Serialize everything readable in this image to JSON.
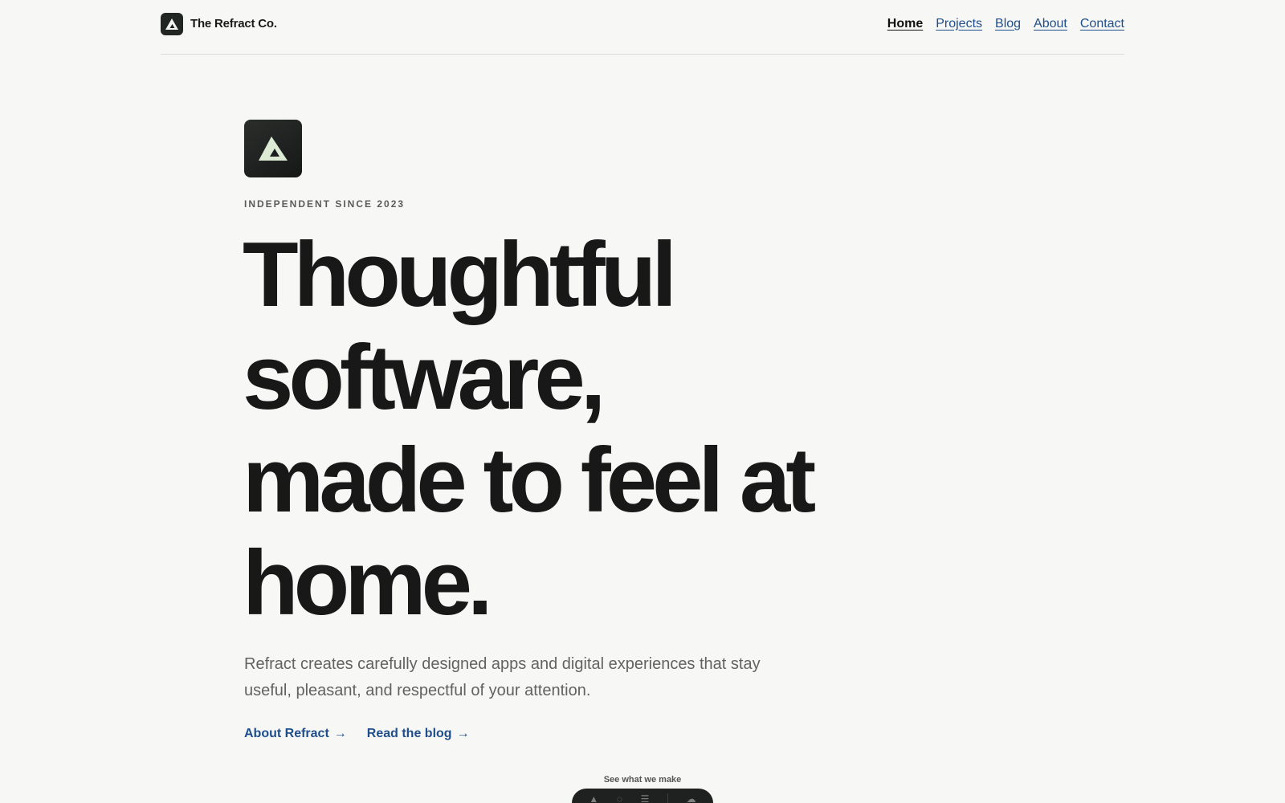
{
  "header": {
    "brand_name": "The Refract Co.",
    "nav": [
      {
        "label": "Home"
      },
      {
        "label": "Projects"
      },
      {
        "label": "Blog"
      },
      {
        "label": "About"
      },
      {
        "label": "Contact"
      }
    ],
    "active_nav": "Home"
  },
  "hero": {
    "eyebrow": "INDEPENDENT SINCE 2023",
    "headline": "Thoughtful software, made to feel at home.",
    "subtitle": "Refract creates carefully designed apps and digital experiences that stay useful, pleasant, and respectful of your attention.",
    "cta_primary": "About Refract",
    "cta_secondary": "Read the blog"
  },
  "dock": {
    "label": "See what we make"
  },
  "colors": {
    "background": "#f7f7f5",
    "link": "#1f4e8c",
    "logo_bg": "#222623",
    "logo_mark": "#dcebd4"
  }
}
